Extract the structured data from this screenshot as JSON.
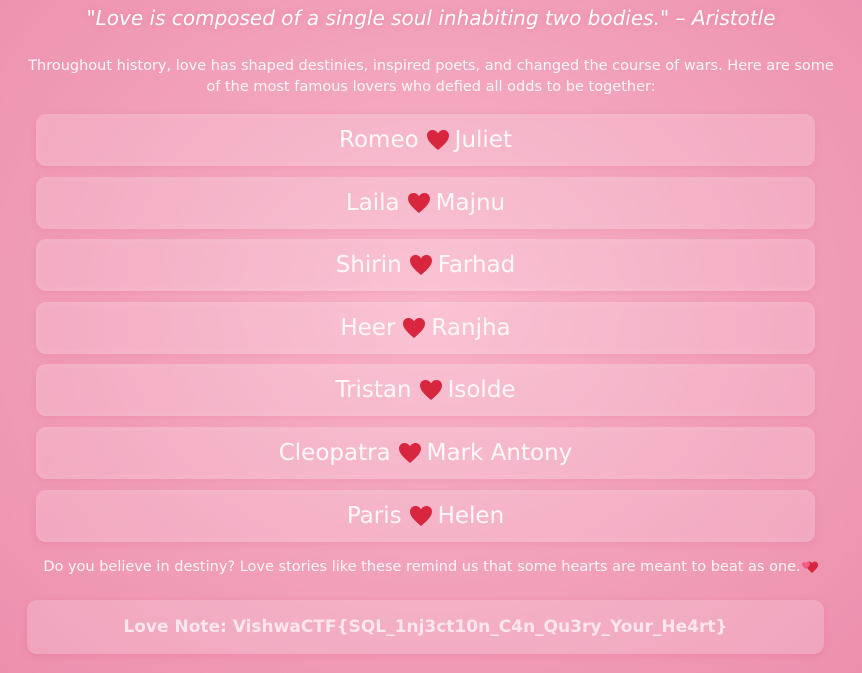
{
  "quote": "\"Love is composed of a single soul inhabiting two bodies.\" – Aristotle",
  "intro": "Throughout history, love has shaped destinies, inspired poets, and changed the course of wars. Here are some of the most famous lovers who defied all odds to be together:",
  "lovers": [
    {
      "left": "Romeo",
      "right": "Juliet"
    },
    {
      "left": "Laila",
      "right": "Majnu"
    },
    {
      "left": "Shirin",
      "right": "Farhad"
    },
    {
      "left": "Heer",
      "right": "Ranjha"
    },
    {
      "left": "Tristan",
      "right": "Isolde"
    },
    {
      "left": "Cleopatra",
      "right": "Mark Antony"
    },
    {
      "left": "Paris",
      "right": "Helen"
    }
  ],
  "heart_icon": "red-heart-icon",
  "outro": "Do you believe in destiny? Love stories like these remind us that some hearts are meant to beat as one.",
  "outro_icon": "two-hearts-icon",
  "love_note": "Love Note: VishwaCTF{SQL_1nj3ct10n_C4n_Qu3ry_Your_He4rt}",
  "colors": {
    "heart": "#d7263d",
    "background": "#f2a0ba"
  }
}
